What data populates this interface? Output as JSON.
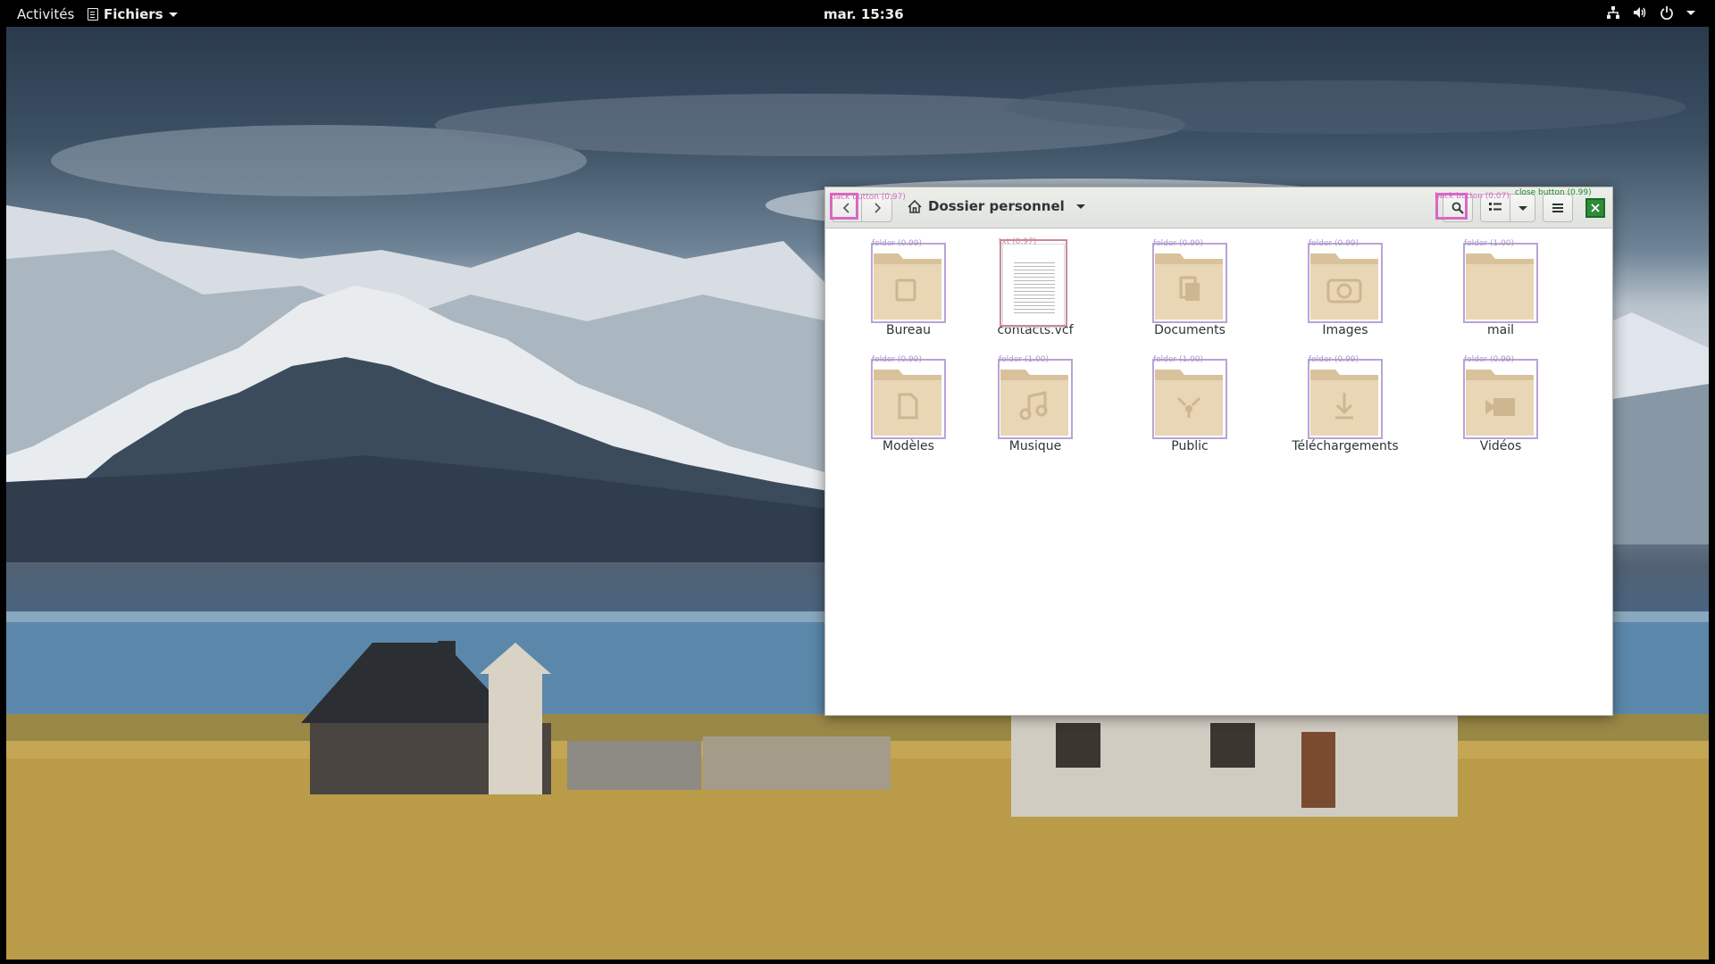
{
  "topbar": {
    "activities": "Activités",
    "app_name": "Fichiers",
    "clock": "mar. 15:36"
  },
  "window": {
    "location": "Dossier personnel",
    "annotations": {
      "back": "back button (0.97)",
      "search": "back button (0.07)",
      "close": "close button (0.99)"
    }
  },
  "files": [
    {
      "name": "Bureau",
      "type": "folder",
      "emblem": "desktop",
      "tag": "folder (0.99)"
    },
    {
      "name": "contacts.vcf",
      "type": "text",
      "emblem": "text",
      "tag": "txt (0.97)"
    },
    {
      "name": "Documents",
      "type": "folder",
      "emblem": "documents",
      "tag": "folder (0.99)"
    },
    {
      "name": "Images",
      "type": "folder",
      "emblem": "camera",
      "tag": "folder (0.99)"
    },
    {
      "name": "mail",
      "type": "folder",
      "emblem": "none",
      "tag": "folder (1.00)"
    },
    {
      "name": "Modèles",
      "type": "folder",
      "emblem": "template",
      "tag": "folder (0.99)"
    },
    {
      "name": "Musique",
      "type": "folder",
      "emblem": "music",
      "tag": "folder (1.00)"
    },
    {
      "name": "Public",
      "type": "folder",
      "emblem": "share",
      "tag": "folder (1.00)"
    },
    {
      "name": "Téléchargements",
      "type": "folder",
      "emblem": "download",
      "tag": "folder (0.99)"
    },
    {
      "name": "Vidéos",
      "type": "folder",
      "emblem": "video",
      "tag": "folder (0.99)"
    }
  ],
  "colors": {
    "folder_body": "#e8d6b5",
    "folder_tab": "#d9c29b",
    "annotation_pink": "#d867c4",
    "annotation_purple": "#b9a4d6",
    "annotation_green": "#1f8a2e"
  }
}
